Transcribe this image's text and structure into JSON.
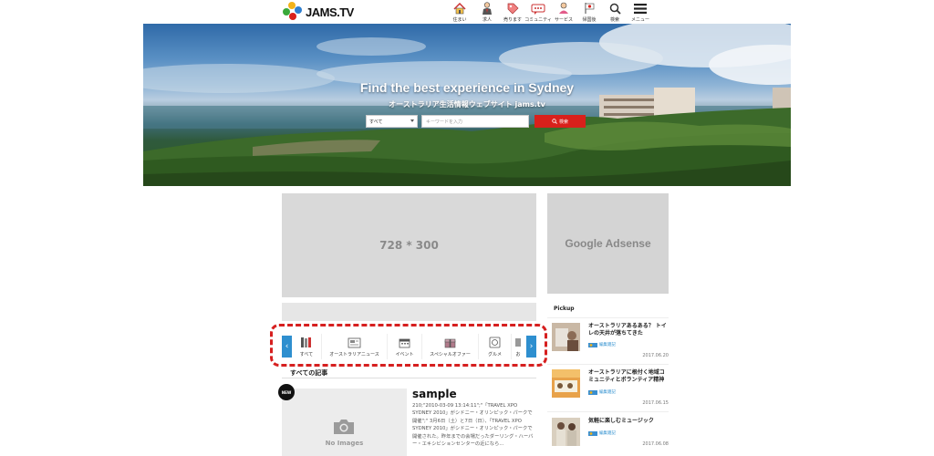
{
  "header": {
    "logo_text": "JAMS.TV",
    "nav": [
      {
        "label": "住まい",
        "icon": "house-icon"
      },
      {
        "label": "求人",
        "icon": "person-icon"
      },
      {
        "label": "売ります",
        "icon": "tag-icon"
      },
      {
        "label": "コミュニティ",
        "icon": "community-icon"
      },
      {
        "label": "サービス",
        "icon": "service-icon"
      },
      {
        "label": "帰国後",
        "icon": "flag-icon"
      },
      {
        "label": "検索",
        "icon": "search-icon"
      },
      {
        "label": "メニュー",
        "icon": "menu-icon"
      }
    ]
  },
  "hero": {
    "title": "Find the best experience in Sydney",
    "subtitle": "オーストラリア生活情報ウェブサイト jams.tv",
    "search": {
      "select_value": "すべて",
      "input_placeholder": "キーワードを入力",
      "button_label": "検索"
    }
  },
  "ads": {
    "main": "728 * 300",
    "side": "Google Adsense"
  },
  "categories": [
    {
      "label": "すべて",
      "icon": "books-icon"
    },
    {
      "label": "オーストラリアニュース",
      "icon": "news-icon"
    },
    {
      "label": "イベント",
      "icon": "calendar-icon"
    },
    {
      "label": "スペシャルオファー",
      "icon": "gift-icon"
    },
    {
      "label": "グルメ",
      "icon": "gourmet-icon"
    },
    {
      "label": "お",
      "icon": "partial-icon"
    }
  ],
  "articles": {
    "section_title": "すべての記事",
    "new_badge": "NEW",
    "no_image_label": "No Images",
    "first": {
      "title": "sample",
      "excerpt": "210;\"2010-03-09 13:14:11\";\"「TRAVEL XPO SYDNEY 2010」がシドニー・オリンピック・パークで開催\";\" 3月6日（土）と7日（日）、「TRAVEL XPO SYDNEY 2010」がシドニー・オリンピック・パークで開催された。昨年までの会場だったダーリング・ハーバー・エキシビションセンターの近になら..."
    }
  },
  "pickup": {
    "label": "Pickup",
    "items": [
      {
        "title": "オーストラリアあるある？ トイレの天井が落ちてきた",
        "author": "編集雑記",
        "date": "2017.06.20"
      },
      {
        "title": "オーストラリアに根付く地域コミュニティとボランティア精神",
        "author": "編集雑記",
        "date": "2017.06.15"
      },
      {
        "title": "気軽に楽しむミュージック",
        "author": "編集雑記",
        "date": "2017.06.08"
      }
    ]
  },
  "colors": {
    "accent_red": "#d9201b",
    "arrow_blue": "#2e8fcf",
    "highlight_dash": "#d61f1f"
  }
}
